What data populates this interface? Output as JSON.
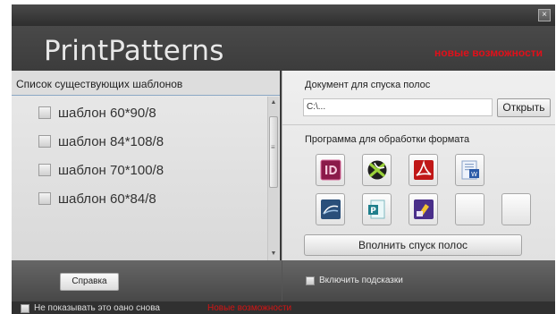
{
  "window": {
    "close_glyph": "×"
  },
  "header": {
    "title": "PrintPatterns",
    "new_features": "новые возможности",
    "new_features_color": "#e0101a"
  },
  "templates": {
    "title": "Список существующих шаблонов",
    "items": [
      {
        "label": "шаблон 60*90/8",
        "checked": false
      },
      {
        "label": "шаблон 84*108/8",
        "checked": false
      },
      {
        "label": "шаблон 70*100/8",
        "checked": false
      },
      {
        "label": "шаблон 60*84/8",
        "checked": false
      }
    ]
  },
  "document": {
    "label": "Документ для спуска полос",
    "path_value": "C:\\...",
    "open_label": "Открыть"
  },
  "programs": {
    "label": "Программа для обработки формата",
    "apps": [
      {
        "icon": "indesign-icon",
        "color": "#8b1a4a"
      },
      {
        "icon": "coreldraw-icon",
        "color": "#3b7a2a"
      },
      {
        "icon": "acrobat-icon",
        "color": "#c01818"
      },
      {
        "icon": "word-icon",
        "color": "#2a5aa8"
      },
      {
        "icon": "openoffice-icon",
        "color": "#2a4f7a"
      },
      {
        "icon": "publisher-icon",
        "color": "#1e7f8c"
      },
      {
        "icon": "pagemaker-icon",
        "color": "#4a2f8a"
      },
      {
        "icon": "empty-slot",
        "color": ""
      },
      {
        "icon": "empty-slot",
        "color": ""
      }
    ],
    "impose_label": "Вполнить спуск полос"
  },
  "footer": {
    "help_label": "Справка",
    "hints_label": "Включить подсказки",
    "dont_show_label": "Не показывать это оано снова",
    "new_features_label": "Новые возможности",
    "new_features_color": "#d41414"
  }
}
